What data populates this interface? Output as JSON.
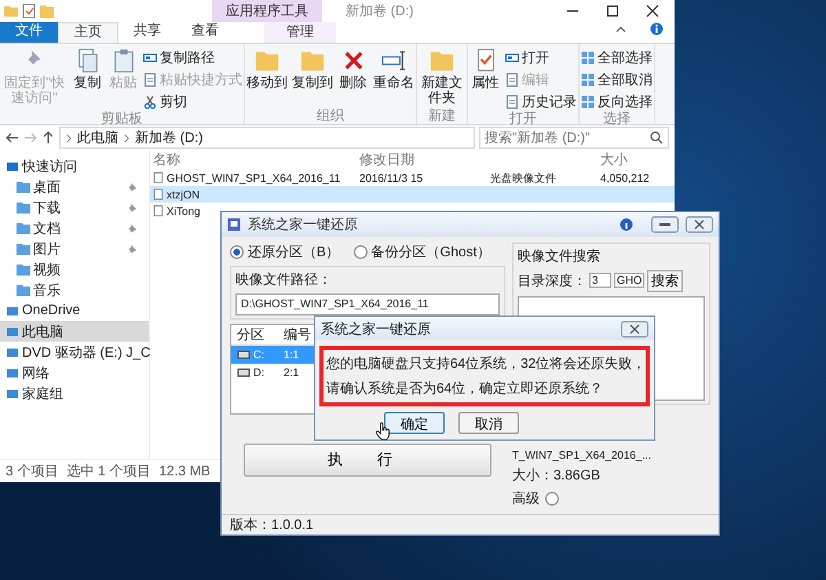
{
  "explorer": {
    "context_tab": "应用程序工具",
    "title": "新加卷 (D:)",
    "tabs": [
      {
        "label": "文件",
        "kind": "file",
        "selected": false
      },
      {
        "label": "主页",
        "kind": "normal",
        "selected": true
      },
      {
        "label": "共享",
        "kind": "normal",
        "selected": false
      },
      {
        "label": "查看",
        "kind": "normal",
        "selected": false
      },
      {
        "label": "管理",
        "kind": "context",
        "selected": false
      }
    ],
    "ribbon": [
      {
        "name": "剪贴板",
        "items": [
          {
            "label": "固定到\"快速访问\"",
            "kind": "large",
            "disabled": true
          },
          {
            "label": "复制",
            "kind": "large",
            "disabled": false
          },
          {
            "label": "粘贴",
            "kind": "large",
            "disabled": true
          },
          {
            "label": "复制路径",
            "kind": "small",
            "disabled": false
          },
          {
            "label": "粘贴快捷方式",
            "kind": "small",
            "disabled": true
          },
          {
            "label": "剪切",
            "kind": "small",
            "disabled": false
          }
        ]
      },
      {
        "name": "组织",
        "items": [
          {
            "label": "移动到",
            "kind": "large",
            "disabled": false
          },
          {
            "label": "复制到",
            "kind": "large",
            "disabled": false
          },
          {
            "label": "删除",
            "kind": "large",
            "disabled": false
          },
          {
            "label": "重命名",
            "kind": "large",
            "disabled": false
          }
        ]
      },
      {
        "name": "新建",
        "items": [
          {
            "label": "新建文件夹",
            "kind": "large",
            "disabled": false
          }
        ]
      },
      {
        "name": "打开",
        "items": [
          {
            "label": "属性",
            "kind": "large",
            "disabled": false
          },
          {
            "label": "打开",
            "kind": "small",
            "disabled": false
          },
          {
            "label": "编辑",
            "kind": "small",
            "disabled": true
          },
          {
            "label": "历史记录",
            "kind": "small",
            "disabled": false
          }
        ]
      },
      {
        "name": "选择",
        "items": [
          {
            "label": "全部选择",
            "kind": "small",
            "disabled": false
          },
          {
            "label": "全部取消",
            "kind": "small",
            "disabled": false
          },
          {
            "label": "反向选择",
            "kind": "small",
            "disabled": false
          }
        ]
      }
    ],
    "address": {
      "path": [
        "此电脑",
        "新加卷 (D:)"
      ],
      "search_placeholder": "搜索\"新加卷 (D:)\""
    },
    "nav": [
      {
        "label": "快速访问",
        "selected": false,
        "children": [
          {
            "label": "桌面",
            "pinned": true
          },
          {
            "label": "下载",
            "pinned": true
          },
          {
            "label": "文档",
            "pinned": true
          },
          {
            "label": "图片",
            "pinned": true
          },
          {
            "label": "视频",
            "pinned": false
          },
          {
            "label": "音乐",
            "pinned": false
          }
        ]
      },
      {
        "label": "OneDrive",
        "selected": false
      },
      {
        "label": "此电脑",
        "selected": true
      },
      {
        "label": "DVD 驱动器 (E:) J_C",
        "selected": false
      },
      {
        "label": "网络",
        "selected": false
      },
      {
        "label": "家庭组",
        "selected": false
      }
    ],
    "headers": {
      "name": "名称",
      "date": "修改日期",
      "size": "大小"
    },
    "files": [
      {
        "name": "GHOST_WIN7_SP1_X64_2016_11",
        "date": "2016/11/3 15",
        "type": "光盘映像文件",
        "size": "4,050,212",
        "selected": false
      },
      {
        "name": "xtzjON",
        "selected": true
      },
      {
        "name": "XiTong",
        "selected": false
      }
    ],
    "status": {
      "count": "3 个项目",
      "selection": "选中 1 个项目",
      "size": "12.3 MB"
    }
  },
  "restore": {
    "title": "系统之家一键还原",
    "radios": [
      {
        "label": "还原分区（B）",
        "selected": true
      },
      {
        "label": "备份分区（Ghost）",
        "selected": false
      }
    ],
    "path_label": "映像文件路径：",
    "path": "D:\\GHOST_WIN7_SP1_X64_2016_11",
    "table_columns": [
      "分区",
      "编号"
    ],
    "partitions": [
      {
        "drive": "C:",
        "number": "1:1",
        "selected": true
      },
      {
        "drive": "D:",
        "number": "2:1",
        "selected": false
      }
    ],
    "search": {
      "title": "映像文件搜索",
      "depth_label": "目录深度：",
      "depth": "3",
      "ext": "GHO",
      "button": "搜索"
    },
    "file_name": "T_WIN7_SP1_X64_2016_...",
    "size": "大小：3.86GB",
    "advanced": {
      "label": "高级",
      "checked": false
    },
    "execute": "执 行",
    "version": "版本：1.0.0.1"
  },
  "msgbox": {
    "title": "系统之家一键还原",
    "lines": [
      "您的电脑硬盘只支持64位系统，32位将会还原失败，",
      "请确认系统是否为64位，确定立即还原系统？"
    ],
    "buttons": [
      {
        "label": "确定",
        "selected": true
      },
      {
        "label": "取消",
        "selected": false
      }
    ]
  }
}
